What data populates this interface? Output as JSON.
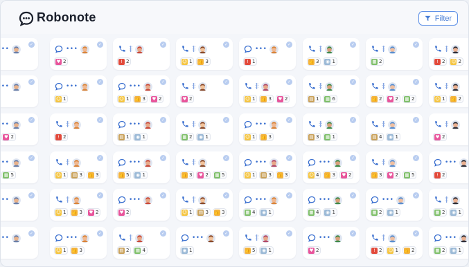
{
  "app": {
    "name": "Robonote"
  },
  "toolbar": {
    "filter_label": "Filter",
    "filter_icon": "funnel-icon"
  },
  "palette": {
    "accent": "#4a7fd6",
    "channel": "#3a6fcf",
    "reaction_colors": {
      "smile": "#f5c542",
      "thumbs": "#f3b23f",
      "heart": "#e8559b",
      "red": "#e24a3b",
      "note": "#c9a15a",
      "eyes": "#9bb9d6",
      "grid": "#7fbf6a"
    }
  },
  "reaction_glyphs": {
    "smile": "☺",
    "thumbs": "👍",
    "heart": "♥",
    "red": "!",
    "note": "▤",
    "eyes": "◉",
    "grid": "▦"
  },
  "cards": [
    [
      {
        "ch": "chat",
        "a": 0,
        "r": [
          [
            "eyes",
            "1"
          ]
        ]
      },
      {
        "ch": "chat",
        "a": 1,
        "r": [
          [
            "heart",
            "2"
          ]
        ]
      },
      {
        "ch": "phone",
        "a": 2,
        "r": [
          [
            "red",
            "2"
          ]
        ]
      },
      {
        "ch": "phone",
        "a": 3,
        "r": [
          [
            "smile",
            "1"
          ],
          [
            "thumbs",
            "3"
          ]
        ]
      },
      {
        "ch": "chat",
        "a": 1,
        "r": [
          [
            "red",
            "1"
          ]
        ]
      },
      {
        "ch": "phone",
        "a": 4,
        "r": [
          [
            "thumbs",
            "3"
          ],
          [
            "eyes",
            "1"
          ]
        ]
      },
      {
        "ch": "phone",
        "a": 5,
        "r": [
          [
            "grid",
            "2"
          ]
        ]
      },
      {
        "ch": "phone",
        "a": 6,
        "r": [
          [
            "red",
            "2"
          ],
          [
            "smile",
            "2"
          ]
        ]
      }
    ],
    [
      {
        "ch": "chat",
        "a": 0,
        "r": [
          [
            "grid",
            "4"
          ]
        ]
      },
      {
        "ch": "chat",
        "a": 1,
        "r": [
          [
            "smile",
            "1"
          ]
        ]
      },
      {
        "ch": "chat",
        "a": 2,
        "r": [
          [
            "smile",
            "1"
          ],
          [
            "thumbs",
            "3"
          ],
          [
            "heart",
            "2"
          ]
        ]
      },
      {
        "ch": "phone",
        "a": 3,
        "r": [
          [
            "heart",
            "2"
          ]
        ]
      },
      {
        "ch": "phone",
        "a": 7,
        "r": [
          [
            "smile",
            "1"
          ],
          [
            "thumbs",
            "3"
          ],
          [
            "heart",
            "2"
          ]
        ]
      },
      {
        "ch": "phone",
        "a": 4,
        "r": [
          [
            "note",
            "1"
          ],
          [
            "grid",
            "6"
          ]
        ]
      },
      {
        "ch": "phone",
        "a": 5,
        "r": [
          [
            "thumbs",
            "2"
          ],
          [
            "heart",
            "2"
          ],
          [
            "grid",
            "2"
          ]
        ]
      },
      {
        "ch": "phone",
        "a": 6,
        "r": [
          [
            "smile",
            "1"
          ],
          [
            "thumbs",
            "2"
          ]
        ]
      }
    ],
    [
      {
        "ch": "chat",
        "a": 0,
        "r": [
          [
            "thumbs",
            "3"
          ],
          [
            "heart",
            "2"
          ]
        ]
      },
      {
        "ch": "phone",
        "a": 1,
        "r": [
          [
            "red",
            "2"
          ]
        ]
      },
      {
        "ch": "chat",
        "a": 2,
        "r": [
          [
            "note",
            "1"
          ],
          [
            "eyes",
            "1"
          ]
        ]
      },
      {
        "ch": "phone",
        "a": 3,
        "r": [
          [
            "grid",
            "2"
          ],
          [
            "eyes",
            "1"
          ]
        ]
      },
      {
        "ch": "chat",
        "a": 1,
        "r": [
          [
            "smile",
            "1"
          ],
          [
            "thumbs",
            "3"
          ]
        ]
      },
      {
        "ch": "phone",
        "a": 4,
        "r": [
          [
            "note",
            "3"
          ],
          [
            "grid",
            "1"
          ]
        ]
      },
      {
        "ch": "phone",
        "a": 5,
        "r": [
          [
            "note",
            "4"
          ],
          [
            "eyes",
            "1"
          ]
        ]
      },
      {
        "ch": "phone",
        "a": 6,
        "r": [
          [
            "heart",
            "2"
          ]
        ]
      }
    ],
    [
      {
        "ch": "chat",
        "a": 0,
        "r": [
          [
            "heart",
            "2"
          ],
          [
            "grid",
            "5"
          ]
        ]
      },
      {
        "ch": "phone",
        "a": 1,
        "r": [
          [
            "smile",
            "1"
          ],
          [
            "note",
            "3"
          ],
          [
            "thumbs",
            "3"
          ]
        ]
      },
      {
        "ch": "chat",
        "a": 2,
        "r": [
          [
            "thumbs",
            "5"
          ],
          [
            "eyes",
            "1"
          ]
        ]
      },
      {
        "ch": "phone",
        "a": 3,
        "r": [
          [
            "thumbs",
            "3"
          ],
          [
            "heart",
            "2"
          ],
          [
            "grid",
            "5"
          ]
        ]
      },
      {
        "ch": "chat",
        "a": 7,
        "r": [
          [
            "smile",
            "1"
          ],
          [
            "note",
            "3"
          ],
          [
            "thumbs",
            "3"
          ]
        ]
      },
      {
        "ch": "chat",
        "a": 4,
        "r": [
          [
            "smile",
            "4"
          ],
          [
            "thumbs",
            "3"
          ],
          [
            "heart",
            "2"
          ]
        ]
      },
      {
        "ch": "phone",
        "a": 5,
        "r": [
          [
            "thumbs",
            "3"
          ],
          [
            "heart",
            "2"
          ],
          [
            "grid",
            "5"
          ]
        ]
      },
      {
        "ch": "chat",
        "a": 6,
        "r": [
          [
            "red",
            "2"
          ]
        ]
      }
    ],
    [
      {
        "ch": "chat",
        "a": 0,
        "r": []
      },
      {
        "ch": "phone",
        "a": 1,
        "r": [
          [
            "smile",
            "1"
          ],
          [
            "thumbs",
            "3"
          ],
          [
            "heart",
            "2"
          ]
        ]
      },
      {
        "ch": "chat",
        "a": 2,
        "r": [
          [
            "heart",
            "2"
          ]
        ]
      },
      {
        "ch": "phone",
        "a": 3,
        "r": [
          [
            "smile",
            "1"
          ],
          [
            "note",
            "3"
          ],
          [
            "thumbs",
            "3"
          ]
        ]
      },
      {
        "ch": "chat",
        "a": 1,
        "r": [
          [
            "grid",
            "4"
          ],
          [
            "eyes",
            "1"
          ]
        ]
      },
      {
        "ch": "chat",
        "a": 4,
        "r": [
          [
            "grid",
            "4"
          ],
          [
            "eyes",
            "1"
          ]
        ]
      },
      {
        "ch": "chat",
        "a": 5,
        "r": [
          [
            "grid",
            "2"
          ],
          [
            "eyes",
            "1"
          ]
        ]
      },
      {
        "ch": "phone",
        "a": 6,
        "r": [
          [
            "grid",
            "2"
          ],
          [
            "eyes",
            "1"
          ]
        ]
      }
    ],
    [
      {
        "ch": "chat",
        "a": 0,
        "r": [
          [
            "eyes",
            "1"
          ]
        ]
      },
      {
        "ch": "chat",
        "a": 1,
        "r": [
          [
            "smile",
            "1"
          ],
          [
            "thumbs",
            "3"
          ]
        ]
      },
      {
        "ch": "phone",
        "a": 2,
        "r": [
          [
            "note",
            "2"
          ],
          [
            "grid",
            "4"
          ]
        ]
      },
      {
        "ch": "chat",
        "a": 3,
        "r": [
          [
            "eyes",
            "1"
          ]
        ]
      },
      {
        "ch": "phone",
        "a": 7,
        "r": [
          [
            "thumbs",
            "5"
          ],
          [
            "eyes",
            "1"
          ]
        ]
      },
      {
        "ch": "chat",
        "a": 4,
        "r": [
          [
            "heart",
            "2"
          ]
        ]
      },
      {
        "ch": "phone",
        "a": 5,
        "r": [
          [
            "red",
            "2"
          ],
          [
            "smile",
            "1"
          ],
          [
            "thumbs",
            "2"
          ]
        ]
      },
      {
        "ch": "chat",
        "a": 6,
        "r": [
          [
            "grid",
            "2"
          ],
          [
            "eyes",
            "1"
          ]
        ]
      }
    ]
  ]
}
